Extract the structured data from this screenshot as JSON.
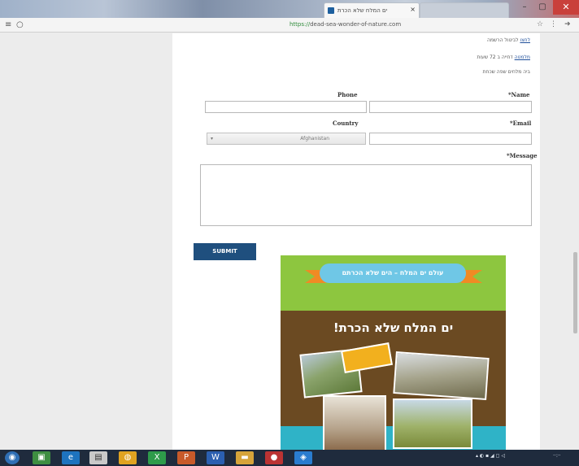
{
  "browser": {
    "tabs": [
      {
        "title": "ים המלח שלא הכרת",
        "active": true
      },
      {
        "title": "",
        "active": false
      }
    ],
    "url_scheme": "https://",
    "url_rest": "dead-sea-wonder-of-nature.com"
  },
  "info_lines": [
    {
      "link": "לחצו",
      "text": " לביטול הרשמה"
    },
    {
      "link": "מלמטה",
      "text": " דחייה ב 72 שעות"
    },
    {
      "link": "",
      "text": "ביה מלחים שפה שכחת"
    }
  ],
  "form": {
    "phone_label": "Phone",
    "name_label": "*Name",
    "country_label": "Country",
    "email_label": "*Email",
    "country_value": "Afghanistan",
    "message_label": "*Message",
    "submit_label": "SUBMIT"
  },
  "poster": {
    "ribbon_text": "עולם ים המלח – הים שלא הכרתם",
    "headline": "ים המלח שלא הכרת!"
  },
  "colors": {
    "accent": "#1f4f7e",
    "poster_green": "#8dc63f",
    "poster_brown": "#6b4a22",
    "poster_teal": "#2fb3c7",
    "ribbon_orange": "#f08a24"
  }
}
